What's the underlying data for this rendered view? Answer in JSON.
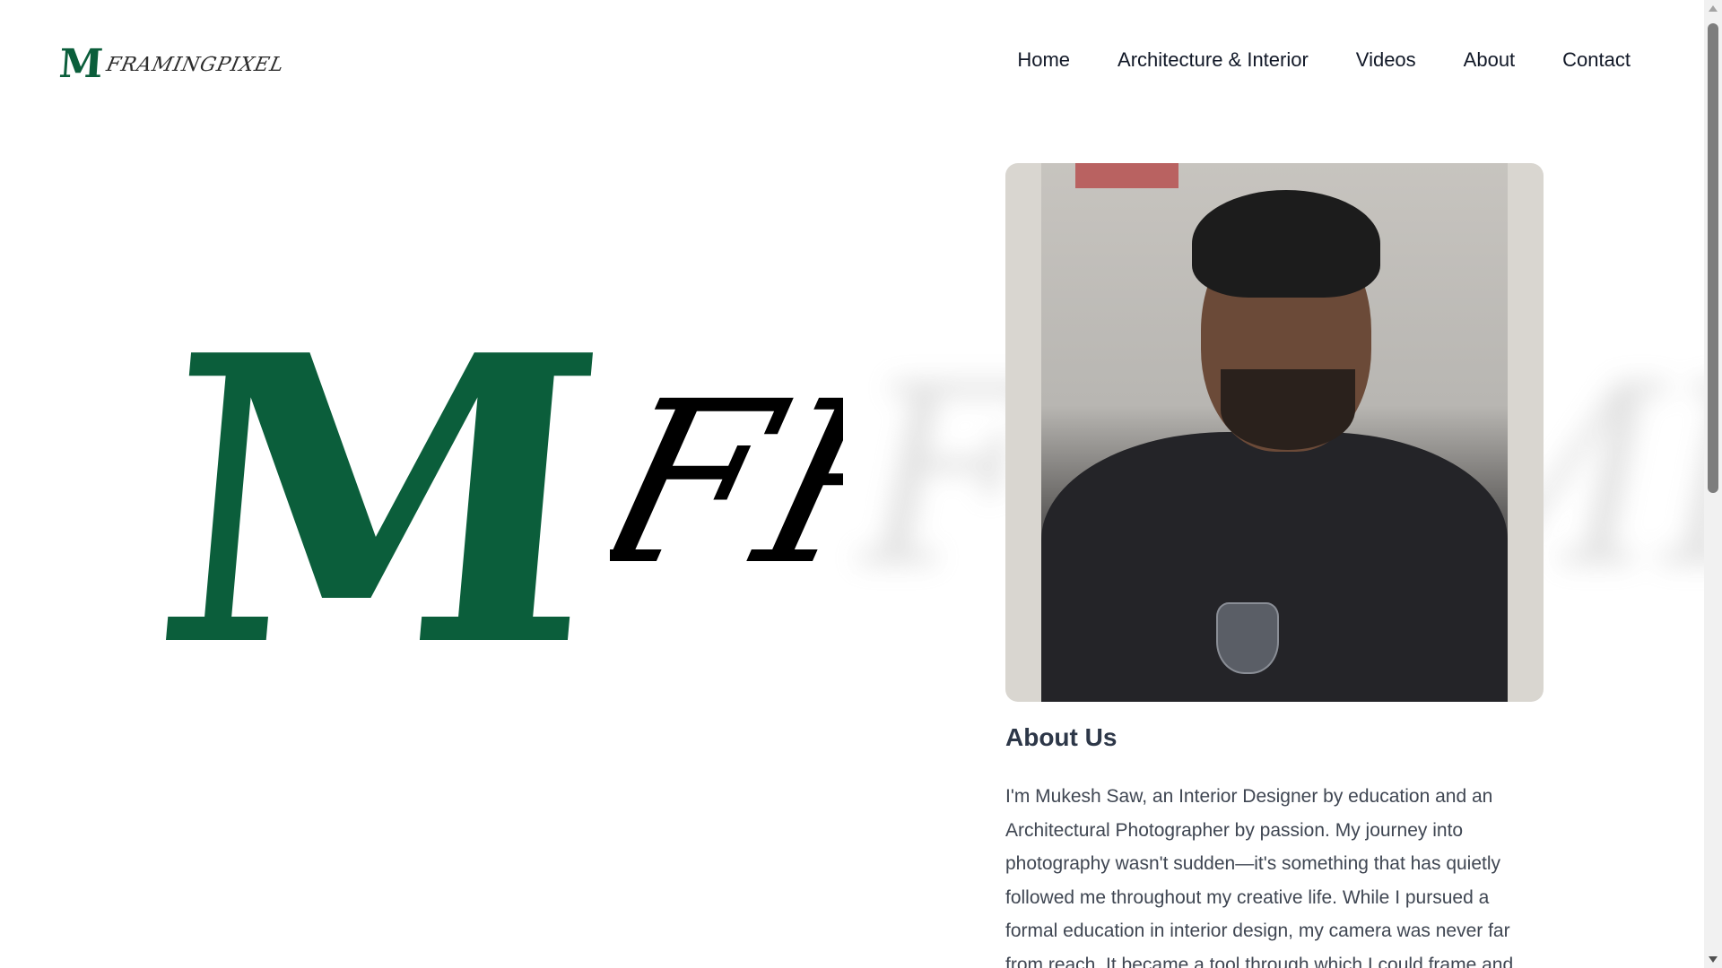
{
  "header": {
    "logo_mark": "M",
    "logo_text": "FRAMINGPIXEL",
    "nav": [
      "Home",
      "Architecture & Interior",
      "Videos",
      "About",
      "Contact"
    ]
  },
  "hero": {
    "mark": "M",
    "word": "FR",
    "ghost": "FRAMINGPIXEL"
  },
  "about": {
    "title": "About Us",
    "body": "I'm Mukesh Saw, an Interior Designer by education and an Architectural Photographer by passion. My journey into photography wasn't sudden—it's something that has quietly followed me throughout my creative life. While I pursued a formal education in interior design, my camera was never far from reach. It became a tool through which I could frame and"
  },
  "colors": {
    "brand_green": "#0b5e3b",
    "heading": "#2d3748",
    "body_text": "#3f4652"
  }
}
